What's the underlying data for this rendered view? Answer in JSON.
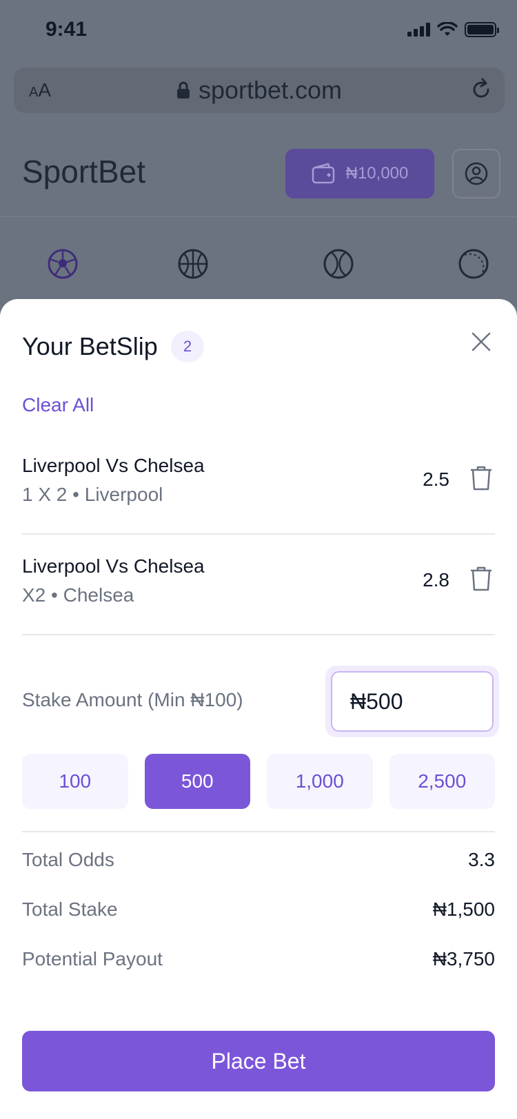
{
  "status_bar": {
    "time": "9:41"
  },
  "browser": {
    "text_size_label_small": "A",
    "text_size_label_large": "A",
    "url": "sportbet.com"
  },
  "header": {
    "brand": "SportBet",
    "wallet_balance": "₦10,000"
  },
  "sports_nav": [
    {
      "icon": "soccer-ball-icon"
    },
    {
      "icon": "basketball-icon"
    },
    {
      "icon": "tennis-ball-icon"
    },
    {
      "icon": "baseball-icon"
    }
  ],
  "betslip": {
    "title": "Your BetSlip",
    "count": "2",
    "clear_all": "Clear All",
    "bets": [
      {
        "match": "Liverpool Vs Chelsea",
        "selection": "1 X 2 • Liverpool",
        "odds": "2.5"
      },
      {
        "match": "Liverpool Vs Chelsea",
        "selection": "X2 • Chelsea",
        "odds": "2.8"
      }
    ],
    "stake_label": "Stake Amount (Min ₦100)",
    "stake_value": "₦500",
    "quick_stakes": [
      "100",
      "500",
      "1,000",
      "2,500"
    ],
    "selected_quick_stake": "500",
    "summary": [
      {
        "label": "Total Odds",
        "value": "3.3"
      },
      {
        "label": "Total Stake",
        "value": "₦1,500"
      },
      {
        "label": "Potential Payout",
        "value": "₦3,750"
      }
    ],
    "place_bet": "Place Bet"
  },
  "colors": {
    "accent": "#7b56d9",
    "accent_text": "#6d4fd3",
    "muted": "#6b7280"
  }
}
